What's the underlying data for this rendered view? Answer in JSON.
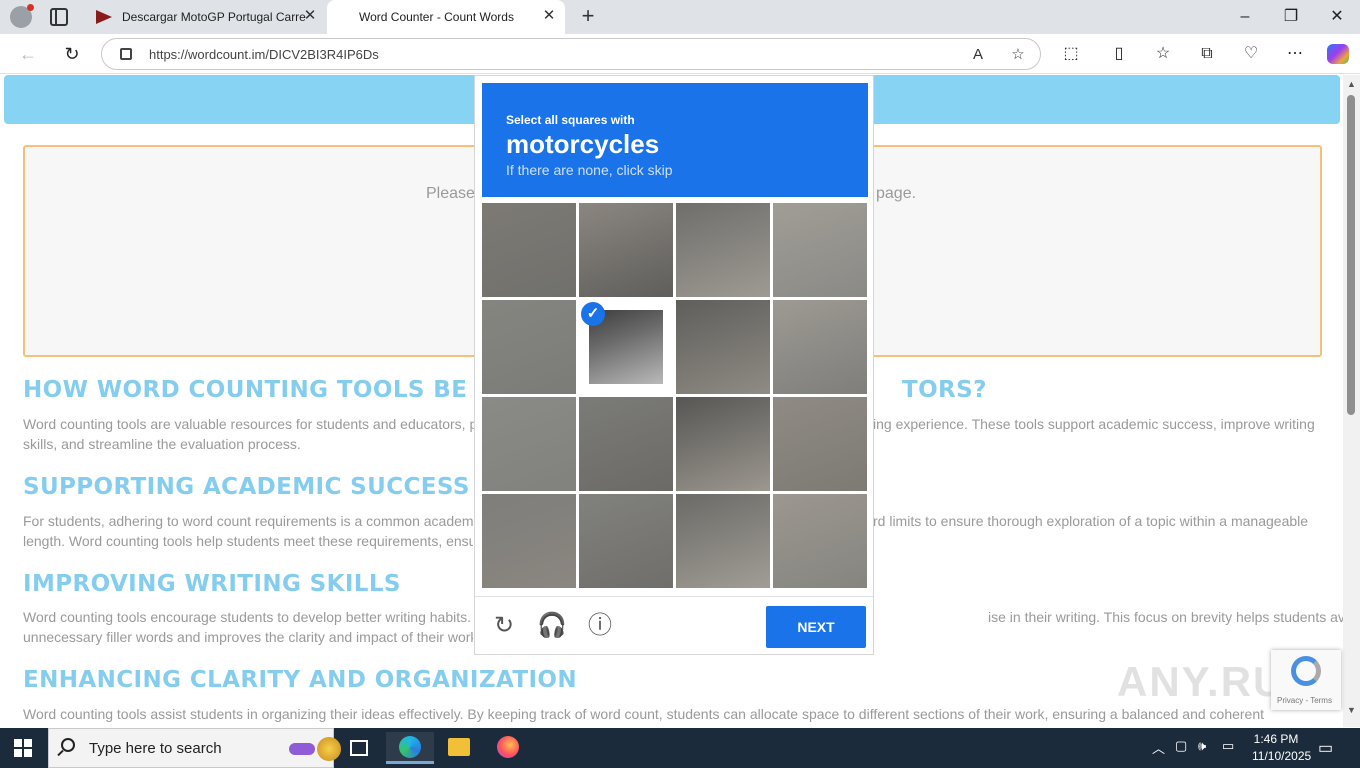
{
  "browser": {
    "tabs": [
      {
        "title": "Descargar MotoGP Portugal Carre",
        "active": false
      },
      {
        "title": "Word Counter - Count Words",
        "active": true
      }
    ],
    "url": "https://wordcount.im/DICV2BI3R4IP6Ds",
    "window_controls": {
      "minimize": "–",
      "maximize": "❐",
      "close": "✕"
    }
  },
  "page": {
    "editor_placeholder_left": "Please",
    "editor_placeholder_right": "page.",
    "sections": [
      {
        "heading_left": "HOW WORD COUNTING TOOLS BE",
        "heading_right": "TORS?",
        "text_line1_left": "Word counting tools are valuable resources for students and educators, p",
        "text_line1_right": "ing experience. These tools support academic success, improve writing",
        "text_line2": "skills, and streamline the evaluation process."
      },
      {
        "heading_left": "SUPPORTING ACADEMIC SUCCESS",
        "text_line1_left": "For students, adhering to word count requirements is a common academ",
        "text_line1_right": "rd limits to ensure thorough exploration of a topic within a manageable",
        "text_line2": "length. Word counting tools help students meet these requirements, ensu"
      },
      {
        "heading_left": "IMPROVING WRITING SKILLS",
        "text_line1_left": "Word counting tools encourage students to develop better writing habits.",
        "text_line1_right": "ise in their writing. This focus on brevity helps students avoid",
        "text_line2": "unnecessary filler words and improves the clarity and impact of their work"
      },
      {
        "heading_left": "ENHANCING CLARITY AND ORGANIZATION",
        "text_line1": "Word counting tools assist students in organizing their ideas effectively. By keeping track of word count, students can allocate space to different sections of their work, ensuring a balanced and coherent"
      }
    ]
  },
  "captcha": {
    "intro": "Select all squares with",
    "target": "motorcycles",
    "subtitle": "If there are none, click skip",
    "grid_size": 4,
    "selected_cells": [
      5
    ],
    "next_label": "NEXT",
    "icons": [
      "reload-icon",
      "audio-icon",
      "info-icon"
    ]
  },
  "recaptcha_badge": {
    "links": "Privacy - Terms"
  },
  "watermark": "ANY.RUN",
  "taskbar": {
    "search_placeholder": "Type here to search",
    "time": "1:46 PM",
    "date": "11/10/2025"
  }
}
